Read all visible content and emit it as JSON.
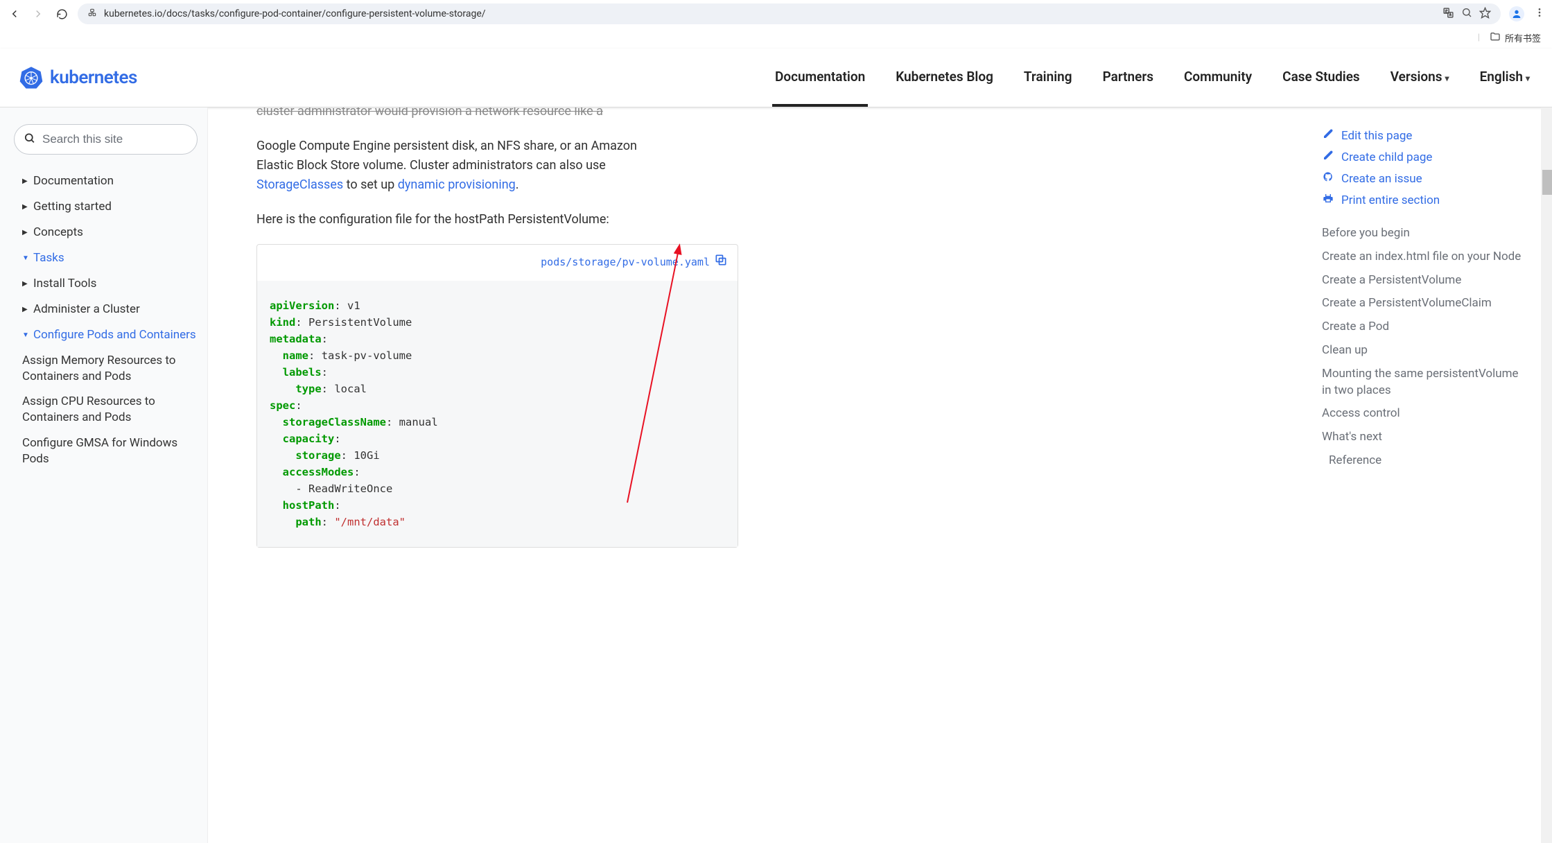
{
  "chrome": {
    "url": "kubernetes.io/docs/tasks/configure-pod-container/configure-persistent-volume-storage/",
    "bookmarks_all": "所有书签"
  },
  "nav": {
    "logo": "kubernetes",
    "items": [
      "Documentation",
      "Kubernetes Blog",
      "Training",
      "Partners",
      "Community",
      "Case Studies",
      "Versions",
      "English"
    ]
  },
  "sidebar": {
    "search_placeholder": "Search this site",
    "top": [
      "Documentation",
      "Getting started",
      "Concepts",
      "Tasks"
    ],
    "tasks_children": [
      "Install Tools",
      "Administer a Cluster",
      "Configure Pods and Containers"
    ],
    "config_children": [
      "Assign Memory Resources to Containers and Pods",
      "Assign CPU Resources to Containers and Pods",
      "Configure GMSA for Windows Pods"
    ]
  },
  "main": {
    "para1_before": "Google Compute Engine persistent disk, an NFS share, or an Amazon Elastic Block Store volume. Cluster administrators can also use ",
    "link1": "StorageClasses",
    "mid": " to set up ",
    "link2": "dynamic provisioning",
    "after": ".",
    "para2": "Here is the configuration file for the hostPath PersistentVolume:",
    "code_path": "pods/storage/pv-volume.yaml",
    "code": {
      "apiVersion": "v1",
      "kind": "PersistentVolume",
      "name": "task-pv-volume",
      "type": "local",
      "storageClassName": "manual",
      "storage": "10Gi",
      "accessMode": "ReadWriteOnce",
      "path": "\"/mnt/data\""
    }
  },
  "actions": {
    "edit": "Edit this page",
    "child": "Create child page",
    "issue": "Create an issue",
    "print": "Print entire section"
  },
  "toc": [
    "Before you begin",
    "Create an index.html file on your Node",
    "Create a PersistentVolume",
    "Create a PersistentVolumeClaim",
    "Create a Pod",
    "Clean up",
    "Mounting the same persistentVolume in two places",
    "Access control",
    "What's next"
  ],
  "toc_indent": "Reference"
}
